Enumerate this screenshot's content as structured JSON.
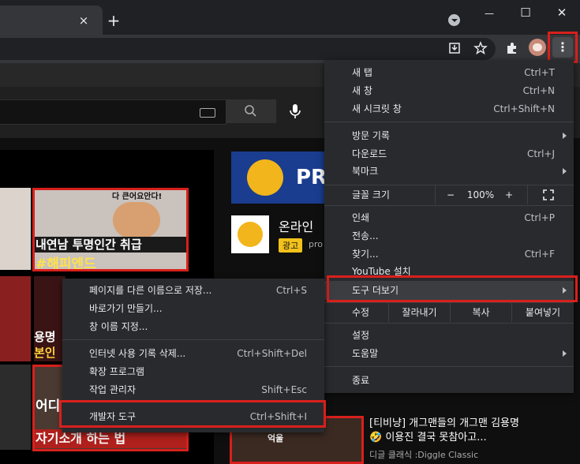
{
  "browser": {
    "tab_close": "×",
    "new_tab": "+",
    "profile_dropdown": "▾",
    "minimize": "—",
    "maximize": "☐",
    "close": "✕",
    "menu_icon": "⋮"
  },
  "youtube": {
    "thumb1_text": "다 큰어요안다!",
    "thumb1_title": "내연남 투명인간 취급",
    "thumb1_tag": "#해피엔드",
    "thumb2_a": "용명",
    "thumb2_b": "본인",
    "thumb3_a": "어디",
    "thumb3_b": "자기소개 하는 법",
    "ad_title": "온라인 ",
    "ad_badge": "광고",
    "ad_domain": "pro",
    "ad_banner": "PR",
    "video_title": "[티비냥] 개그맨들의 개그맨 김용명🤣 이용진 결국 못참아고...",
    "video_channel": "디글 클래식 :Diggle Classic",
    "thumb_small": "억울"
  },
  "main_menu": {
    "new_tab": {
      "label": "새 탭",
      "shortcut": "Ctrl+T"
    },
    "new_window": {
      "label": "새 창",
      "shortcut": "Ctrl+N"
    },
    "incognito": {
      "label": "새 시크릿 창",
      "shortcut": "Ctrl+Shift+N"
    },
    "history": {
      "label": "방문 기록"
    },
    "downloads": {
      "label": "다운로드",
      "shortcut": "Ctrl+J"
    },
    "bookmarks": {
      "label": "북마크"
    },
    "zoom": {
      "label": "글꼴 크기",
      "minus": "−",
      "value": "100%",
      "plus": "+"
    },
    "print": {
      "label": "인쇄",
      "shortcut": "Ctrl+P"
    },
    "cast": {
      "label": "전송..."
    },
    "find": {
      "label": "찾기...",
      "shortcut": "Ctrl+F"
    },
    "install": {
      "label": "YouTube 설치"
    },
    "more_tools": {
      "label": "도구 더보기"
    },
    "edit": {
      "label": "수정",
      "cut": "잘라내기",
      "copy": "복사",
      "paste": "붙여넣기"
    },
    "settings": {
      "label": "설정"
    },
    "help": {
      "label": "도움말"
    },
    "exit": {
      "label": "종료"
    }
  },
  "sub_menu": {
    "save_page": {
      "label": "페이지를 다른 이름으로 저장...",
      "shortcut": "Ctrl+S"
    },
    "create_shortcut": {
      "label": "바로가기 만들기..."
    },
    "name_window": {
      "label": "창 이름 지정..."
    },
    "clear_data": {
      "label": "인터넷 사용 기록 삭제...",
      "shortcut": "Ctrl+Shift+Del"
    },
    "extensions": {
      "label": "확장 프로그램"
    },
    "task_manager": {
      "label": "작업 관리자",
      "shortcut": "Shift+Esc"
    },
    "dev_tools": {
      "label": "개발자 도구",
      "shortcut": "Ctrl+Shift+I"
    }
  },
  "colors": {
    "highlight": "#d8201c",
    "menu_bg": "#292a2d"
  }
}
